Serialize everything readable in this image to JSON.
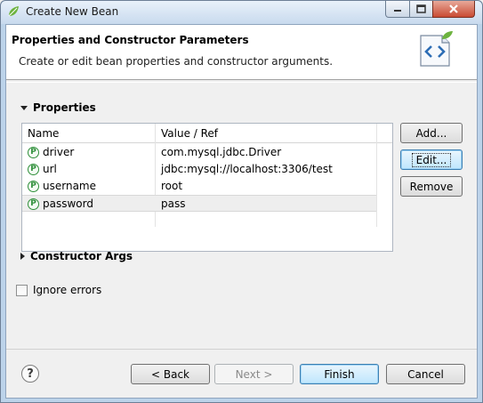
{
  "window": {
    "title": "Create New Bean"
  },
  "banner": {
    "title": "Properties and Constructor Parameters",
    "description": "Create or edit bean properties and constructor arguments."
  },
  "properties": {
    "heading": "Properties",
    "columns": [
      "Name",
      "Value / Ref"
    ],
    "rows": [
      {
        "name": "driver",
        "value": "com.mysql.jdbc.Driver"
      },
      {
        "name": "url",
        "value": "jdbc:mysql://localhost:3306/test"
      },
      {
        "name": "username",
        "value": "root"
      },
      {
        "name": "password",
        "value": "pass"
      }
    ],
    "buttons": {
      "add": "Add...",
      "edit": "Edit...",
      "remove": "Remove"
    }
  },
  "constructor": {
    "heading": "Constructor Args"
  },
  "options": {
    "ignore_errors": "Ignore errors"
  },
  "footer": {
    "back": "< Back",
    "next": "Next >",
    "finish": "Finish",
    "cancel": "Cancel",
    "help": "?"
  }
}
